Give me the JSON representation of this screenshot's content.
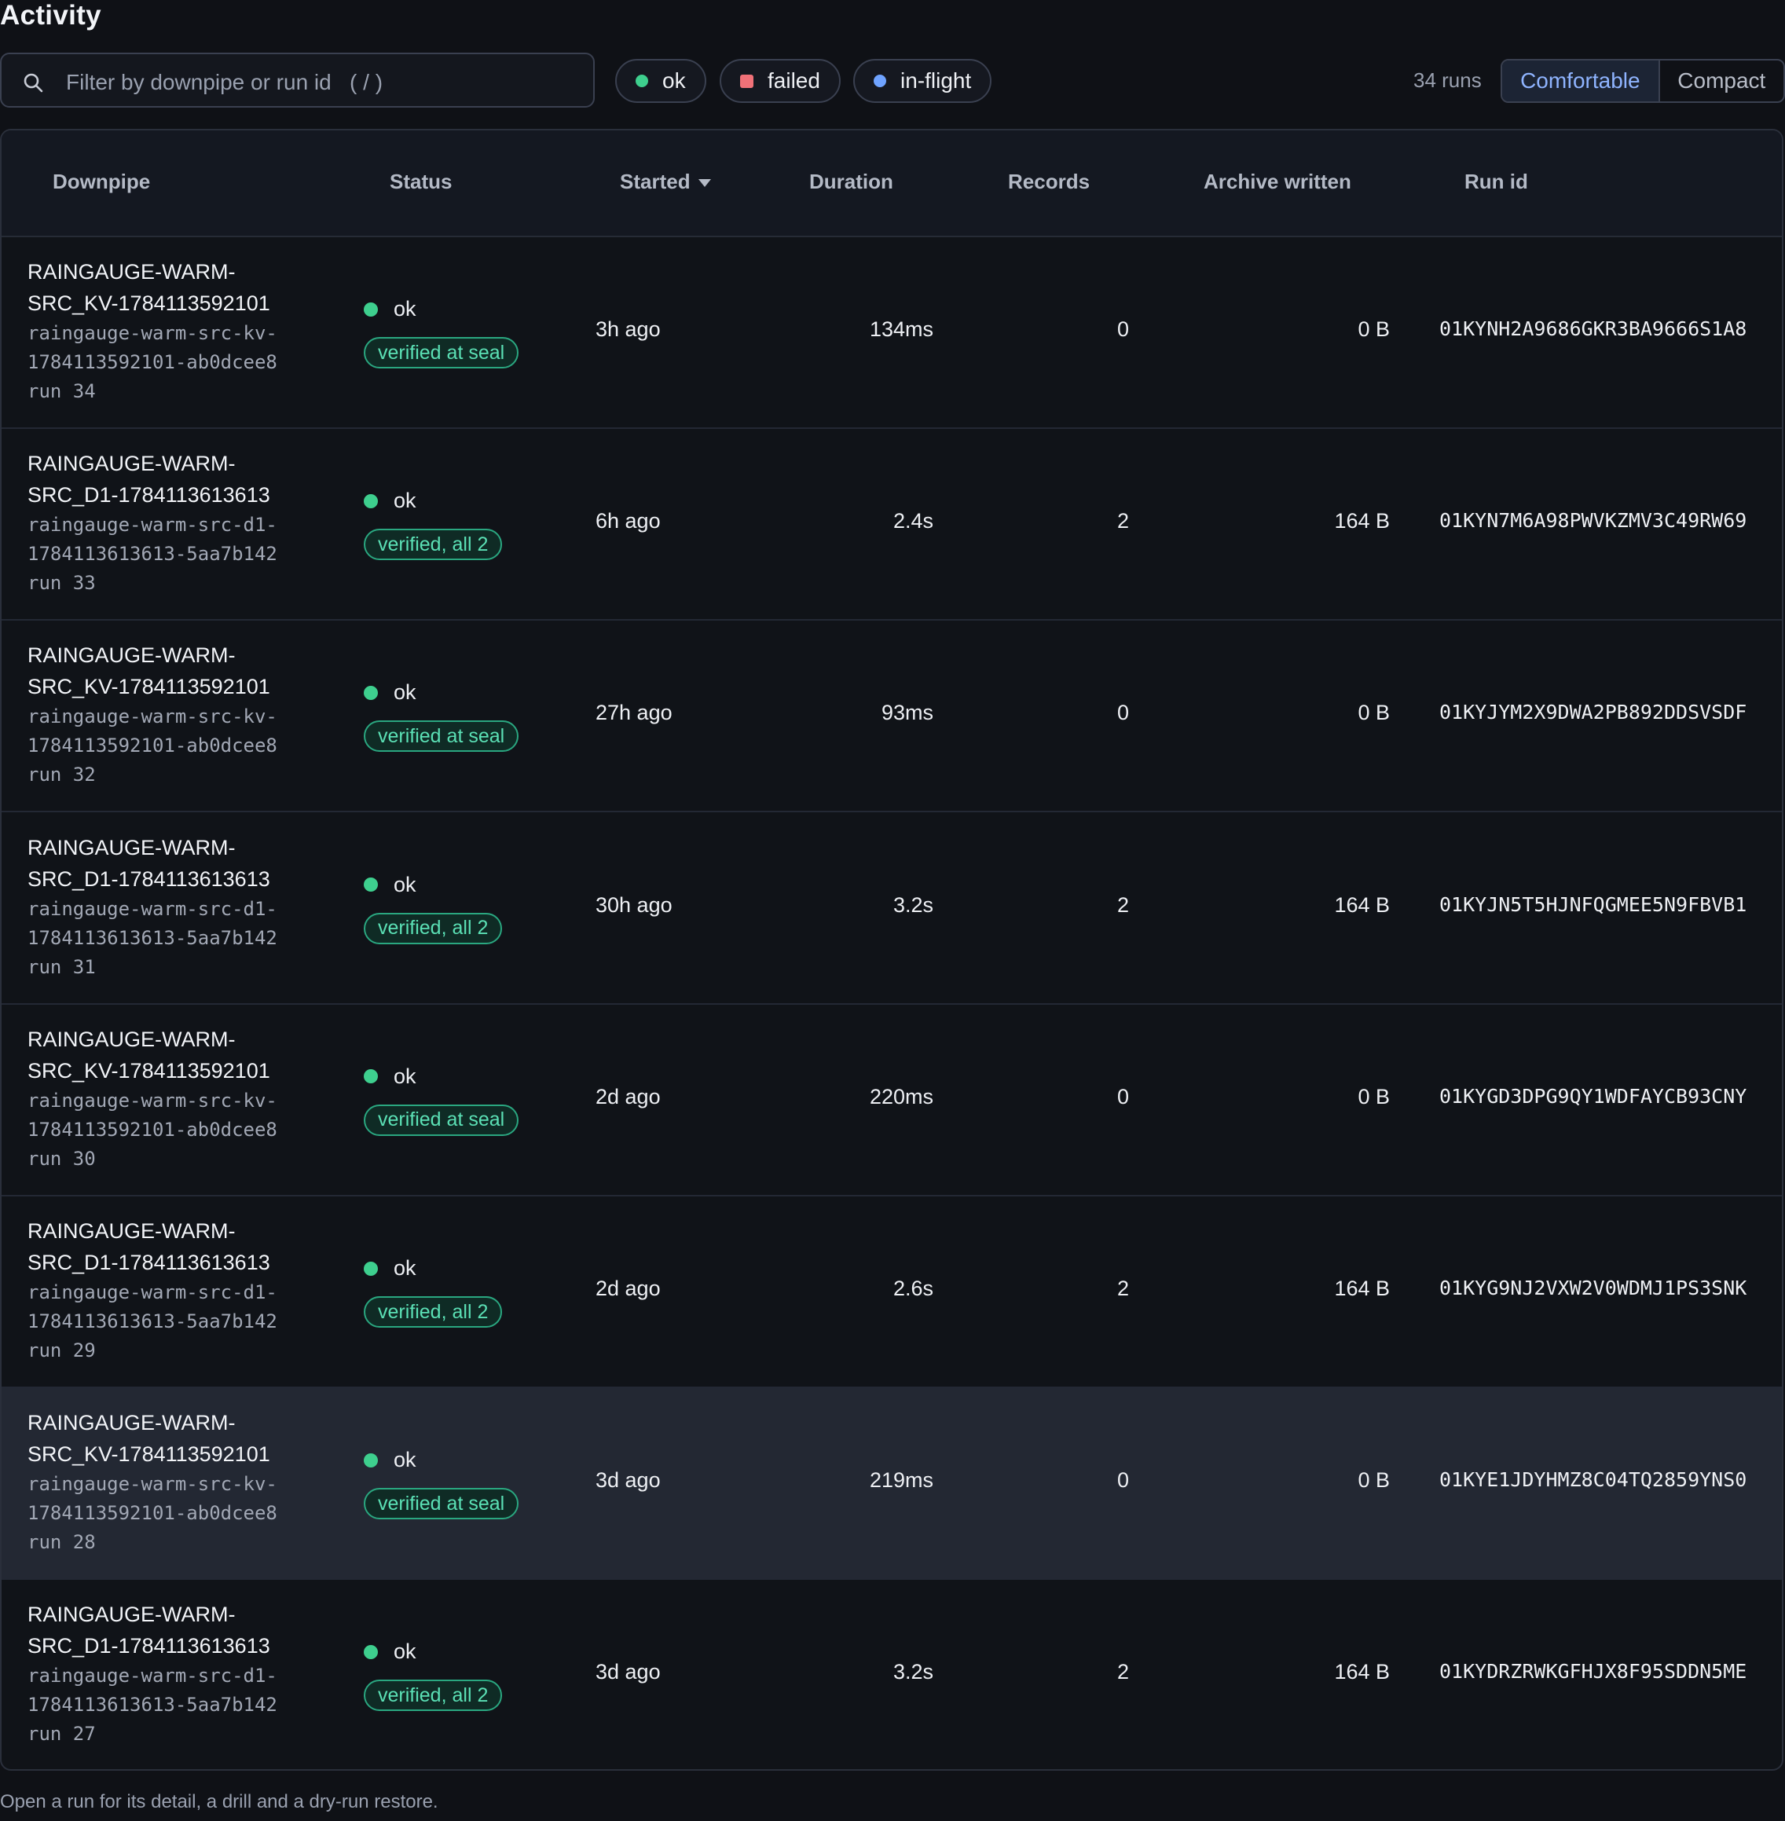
{
  "page": {
    "title": "Activity",
    "footer": "Open a run for its detail, a drill and a dry-run restore."
  },
  "toolbar": {
    "search_placeholder": "Filter by downpipe or run id   ( / )",
    "filters": [
      {
        "label": "ok",
        "color": "#3ecf8e"
      },
      {
        "label": "failed",
        "color": "#f07178"
      },
      {
        "label": "in-flight",
        "color": "#6fa3ff"
      }
    ],
    "runs_count": "34 runs",
    "density": {
      "comfortable": "Comfortable",
      "compact": "Compact",
      "selected": "Comfortable"
    }
  },
  "table": {
    "columns": {
      "downpipe": "Downpipe",
      "status": "Status",
      "started": "Started",
      "duration": "Duration",
      "records": "Records",
      "archive": "Archive written",
      "run_id": "Run id"
    },
    "rows": [
      {
        "name": "RAINGAUGE-WARM-SRC_KV-1784113592101",
        "slug": "raingauge-warm-src-kv-1784113592101-ab0dcee8",
        "run": "run 34",
        "status": "ok",
        "badge": "verified at seal",
        "started": "3h ago",
        "duration": "134ms",
        "records": "0",
        "archive": "0 B",
        "run_id": "01KYNH2A9686GKR3BA9666S1A8"
      },
      {
        "name": "RAINGAUGE-WARM-SRC_D1-1784113613613",
        "slug": "raingauge-warm-src-d1-1784113613613-5aa7b142",
        "run": "run 33",
        "status": "ok",
        "badge": "verified, all 2",
        "started": "6h ago",
        "duration": "2.4s",
        "records": "2",
        "archive": "164 B",
        "run_id": "01KYN7M6A98PWVKZMV3C49RW69"
      },
      {
        "name": "RAINGAUGE-WARM-SRC_KV-1784113592101",
        "slug": "raingauge-warm-src-kv-1784113592101-ab0dcee8",
        "run": "run 32",
        "status": "ok",
        "badge": "verified at seal",
        "started": "27h ago",
        "duration": "93ms",
        "records": "0",
        "archive": "0 B",
        "run_id": "01KYJYM2X9DWA2PB892DDSVSDF"
      },
      {
        "name": "RAINGAUGE-WARM-SRC_D1-1784113613613",
        "slug": "raingauge-warm-src-d1-1784113613613-5aa7b142",
        "run": "run 31",
        "status": "ok",
        "badge": "verified, all 2",
        "started": "30h ago",
        "duration": "3.2s",
        "records": "2",
        "archive": "164 B",
        "run_id": "01KYJN5T5HJNFQGMEE5N9FBVB1"
      },
      {
        "name": "RAINGAUGE-WARM-SRC_KV-1784113592101",
        "slug": "raingauge-warm-src-kv-1784113592101-ab0dcee8",
        "run": "run 30",
        "status": "ok",
        "badge": "verified at seal",
        "started": "2d ago",
        "duration": "220ms",
        "records": "0",
        "archive": "0 B",
        "run_id": "01KYGD3DPG9QY1WDFAYCB93CNY"
      },
      {
        "name": "RAINGAUGE-WARM-SRC_D1-1784113613613",
        "slug": "raingauge-warm-src-d1-1784113613613-5aa7b142",
        "run": "run 29",
        "status": "ok",
        "badge": "verified, all 2",
        "started": "2d ago",
        "duration": "2.6s",
        "records": "2",
        "archive": "164 B",
        "run_id": "01KYG9NJ2VXW2V0WDMJ1PS3SNK"
      },
      {
        "name": "RAINGAUGE-WARM-SRC_KV-1784113592101",
        "slug": "raingauge-warm-src-kv-1784113592101-ab0dcee8",
        "run": "run 28",
        "status": "ok",
        "badge": "verified at seal",
        "started": "3d ago",
        "duration": "219ms",
        "records": "0",
        "archive": "0 B",
        "run_id": "01KYE1JDYHMZ8C04TQ2859YNS0",
        "hover": true
      },
      {
        "name": "RAINGAUGE-WARM-SRC_D1-1784113613613",
        "slug": "raingauge-warm-src-d1-1784113613613-5aa7b142",
        "run": "run 27",
        "status": "ok",
        "badge": "verified, all 2",
        "started": "3d ago",
        "duration": "3.2s",
        "records": "2",
        "archive": "164 B",
        "run_id": "01KYDRZRWKGFHJX8F95SDDN5ME"
      }
    ]
  }
}
